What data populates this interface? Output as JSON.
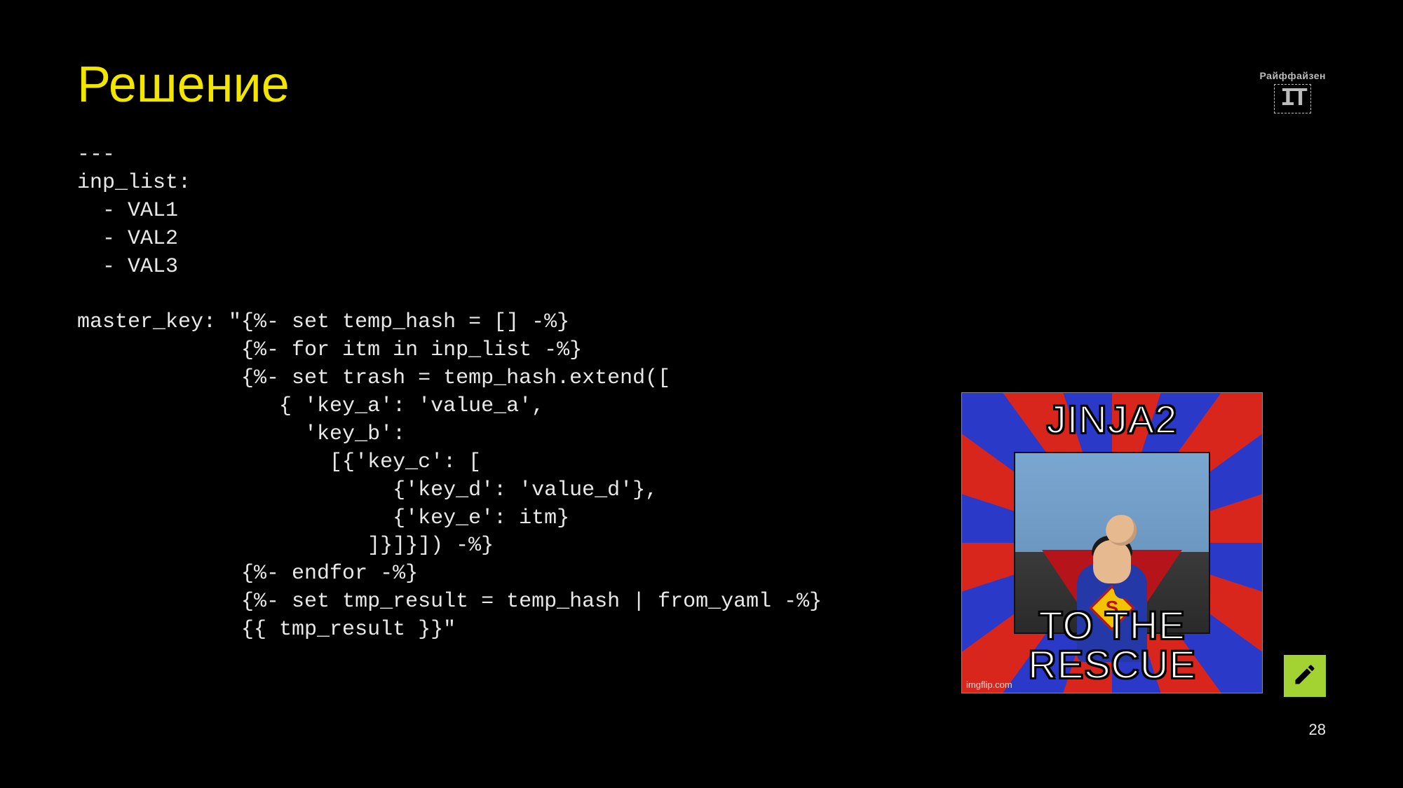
{
  "title": "Решение",
  "logo": {
    "brand": "Райффайзен",
    "sub": "IT"
  },
  "code": "---\ninp_list:\n  - VAL1\n  - VAL2\n  - VAL3\n\nmaster_key: \"{%- set temp_hash = [] -%}\n             {%- for itm in inp_list -%}\n             {%- set trash = temp_hash.extend([\n                { 'key_a': 'value_a',\n                  'key_b':\n                    [{'key_c': [\n                         {'key_d': 'value_d'},\n                         {'key_e': itm}\n                       ]}]}]) -%}\n             {%- endfor -%}\n             {%- set tmp_result = temp_hash | from_yaml -%}\n             {{ tmp_result }}\"",
  "meme": {
    "top": "JINJA2",
    "bottom": "TO THE RESCUE",
    "credit": "imgflip.com"
  },
  "page_number": "28"
}
